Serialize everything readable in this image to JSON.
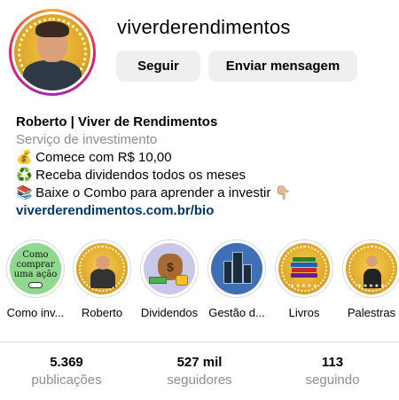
{
  "profile": {
    "username": "viverderendimentos",
    "avatar_icon": "profile-photo-avatar",
    "story_ring_colors": [
      "#f9a825",
      "#e91e63",
      "#9c27b0"
    ]
  },
  "actions": {
    "follow_label": "Seguir",
    "message_label": "Enviar mensagem"
  },
  "bio": {
    "name": "Roberto | Viver de Rendimentos",
    "category": "Serviço de investimento",
    "lines": [
      {
        "emoji": "💰",
        "text": "Comece com R$ 10,00"
      },
      {
        "emoji": "♻️",
        "text": "Receba dividendos todos os meses"
      },
      {
        "emoji": "📚",
        "text": "Baixe o Combo para aprender a investir 👇🏼"
      }
    ],
    "link": "viverderendimentos.com.br/bio",
    "link_color": "#00376b"
  },
  "highlights": [
    {
      "label": "Como inv...",
      "cover_text": "Como comprar uma ação",
      "icon": "how-to-buy-cover"
    },
    {
      "label": "Roberto",
      "icon": "roberto-portrait-cover"
    },
    {
      "label": "Dividendos",
      "icon": "money-bag-cover"
    },
    {
      "label": "Gestão d...",
      "icon": "buildings-cover"
    },
    {
      "label": "Livros",
      "icon": "books-cover"
    },
    {
      "label": "Palestras",
      "icon": "speaker-cover"
    }
  ],
  "stats": [
    {
      "value": "5.369",
      "label": "publicações"
    },
    {
      "value": "527 mil",
      "label": "seguidores"
    },
    {
      "value": "113",
      "label": "seguindo"
    }
  ]
}
